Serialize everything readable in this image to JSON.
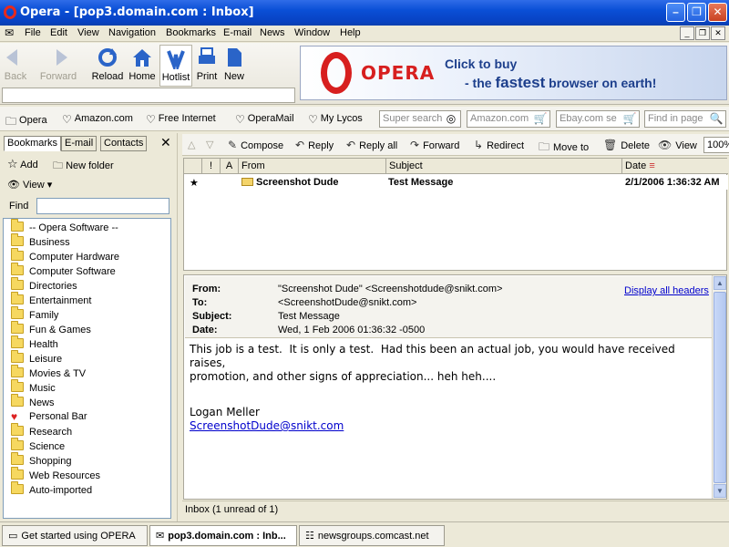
{
  "window": {
    "title": "Opera - [pop3.domain.com : Inbox]"
  },
  "menu": [
    "File",
    "Edit",
    "View",
    "Navigation",
    "Bookmarks",
    "E-mail",
    "News",
    "Window",
    "Help"
  ],
  "toolbar": {
    "back": "Back",
    "forward": "Forward",
    "reload": "Reload",
    "home": "Home",
    "hotlist": "Hotlist",
    "print": "Print",
    "new": "New"
  },
  "banner": {
    "brand": "OPERA",
    "line1": "Click to buy",
    "line2_pre": "- the ",
    "line2_bold": "fastest",
    "line2_post": " browser on earth!"
  },
  "personal_bar": {
    "items": [
      "Opera",
      "Amazon.com",
      "Free Internet",
      "OperaMail",
      "My Lycos"
    ],
    "search_fields": [
      "Super search",
      "Amazon.com",
      "Ebay.com se",
      "Find in page"
    ]
  },
  "panel": {
    "tabs": [
      "Bookmarks",
      "E-mail",
      "Contacts"
    ],
    "add": "Add",
    "new_folder": "New folder",
    "view": "View",
    "find": "Find",
    "bookmarks": [
      "-- Opera Software --",
      "Business",
      "Computer Hardware",
      "Computer Software",
      "Directories",
      "Entertainment",
      "Family",
      "Fun & Games",
      "Health",
      "Leisure",
      "Movies & TV",
      "Music",
      "News",
      "Personal Bar",
      "Research",
      "Science",
      "Shopping",
      "Web Resources",
      "Auto-imported"
    ]
  },
  "mail_toolbar": {
    "compose": "Compose",
    "reply": "Reply",
    "reply_all": "Reply all",
    "forward": "Forward",
    "redirect": "Redirect",
    "move_to": "Move to",
    "delete": "Delete",
    "view": "View",
    "zoom": "100%"
  },
  "message_list": {
    "columns": [
      "!",
      "A",
      "From",
      "Subject",
      "Date"
    ],
    "rows": [
      {
        "star": "★",
        "from": "Screenshot Dude",
        "subject": "Test Message",
        "date": "2/1/2006 1:36:32 AM"
      }
    ]
  },
  "message": {
    "labels": {
      "from": "From:",
      "to": "To:",
      "subject": "Subject:",
      "date": "Date:"
    },
    "from": "\"Screenshot Dude\" <Screenshotdude@snikt.com>",
    "to": "<ScreenshotDude@snikt.com>",
    "subject": "Test Message",
    "date": "Wed, 1 Feb 2006 01:36:32 -0500",
    "display_all_headers": "Display all headers",
    "body": "This job is a test.  It is only a test.  Had this been an actual job, you would have received raises,\npromotion, and other signs of appreciation... heh heh....",
    "sig_name": "Logan Meller",
    "sig_email": "ScreenshotDude@snikt.com"
  },
  "status": {
    "mail": "Inbox (1 unread of 1)"
  },
  "window_tabs": [
    "Get started using OPERA",
    "pop3.domain.com : Inb...",
    "newsgroups.comcast.net"
  ],
  "colors": {
    "titlebar": "#0a4fd6",
    "opera_red": "#d71f1f",
    "link": "#0000cc"
  }
}
